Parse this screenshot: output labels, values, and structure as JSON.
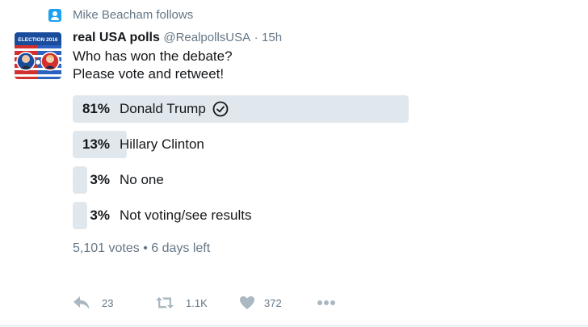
{
  "social_context": {
    "text": "Mike Beacham follows"
  },
  "avatar": {
    "text": "ELECTION 2016",
    "accent": "#1a4c9c",
    "stripe": "#d22f2f"
  },
  "header": {
    "name": "real USA polls",
    "handle": "@RealpollsUSA",
    "separator": "·",
    "time": "15h"
  },
  "tweet": {
    "line1": "Who has won the debate?",
    "line2": "Please vote and retweet!"
  },
  "poll": {
    "choices": [
      {
        "percent": "81%",
        "label": "Donald Trump",
        "fraction": 0.81,
        "selected": true
      },
      {
        "percent": "13%",
        "label": "Hillary Clinton",
        "fraction": 0.13,
        "selected": false
      },
      {
        "percent": "3%",
        "label": "No one",
        "fraction": 0.03,
        "selected": false
      },
      {
        "percent": "3%",
        "label": "Not voting/see results",
        "fraction": 0.03,
        "selected": false
      }
    ],
    "votes": "5,101 votes",
    "meta_separator": "•",
    "time_left": "6 days left"
  },
  "actions": {
    "reply_count": "23",
    "retweet_count": "1.1K",
    "like_count": "372"
  },
  "colors": {
    "bar": "#e1e8ed",
    "accent": "#1da1f2",
    "muted": "#657786"
  }
}
